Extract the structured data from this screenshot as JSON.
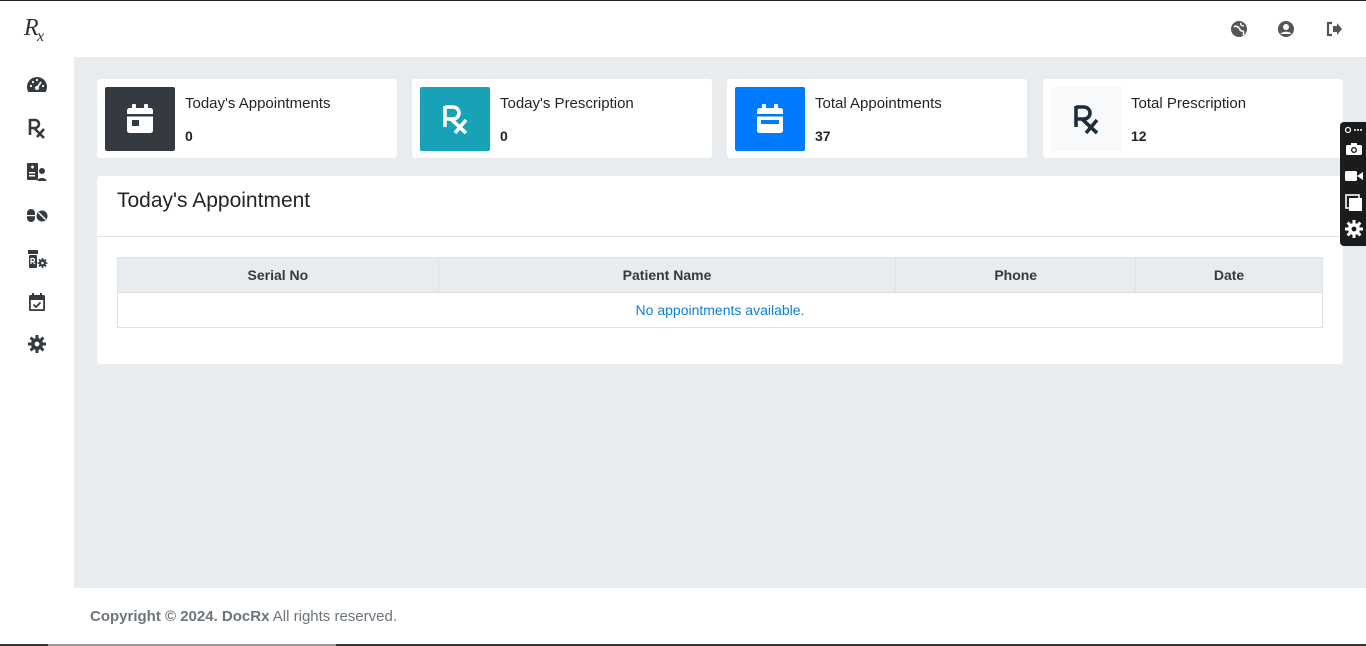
{
  "header": {
    "logo_text": "Rx",
    "icons": [
      "globe-icon",
      "user-circle-icon",
      "sign-out-icon"
    ]
  },
  "sidebar": {
    "items": [
      {
        "icon": "tachometer-icon"
      },
      {
        "icon": "prescription-icon"
      },
      {
        "icon": "patient-card-icon"
      },
      {
        "icon": "pills-icon"
      },
      {
        "icon": "prescription-bottle-gear-icon"
      },
      {
        "icon": "calendar-check-icon"
      },
      {
        "icon": "gear-icon"
      }
    ]
  },
  "cards": [
    {
      "title": "Today's Appointments",
      "value": "0",
      "icon": "calendar-icon",
      "color": "#343a40"
    },
    {
      "title": "Today's Prescription",
      "value": "0",
      "icon": "prescription-icon",
      "color": "#17a2b8"
    },
    {
      "title": "Total Appointments",
      "value": "37",
      "icon": "calendar-icon",
      "color": "#007bff"
    },
    {
      "title": "Total Prescription",
      "value": "12",
      "icon": "prescription-icon",
      "color": "#f8f9fa"
    }
  ],
  "appointment_panel": {
    "title": "Today's Appointment",
    "columns": [
      "Serial No",
      "Patient Name",
      "Phone",
      "Date"
    ],
    "empty_message": "No appointments available."
  },
  "footer": {
    "copyright": "Copyright © 2024. DocRx",
    "rights": " All rights reserved."
  },
  "floating_toolbar": {
    "icons": [
      "link-more-icon",
      "camera-icon",
      "video-icon",
      "window-icon",
      "gear-icon"
    ]
  },
  "colors": {
    "main_bg": "#e9ecef",
    "link_blue": "#0d7fd8",
    "dark": "#343a40",
    "teal": "#17a2b8",
    "blue": "#007bff"
  }
}
